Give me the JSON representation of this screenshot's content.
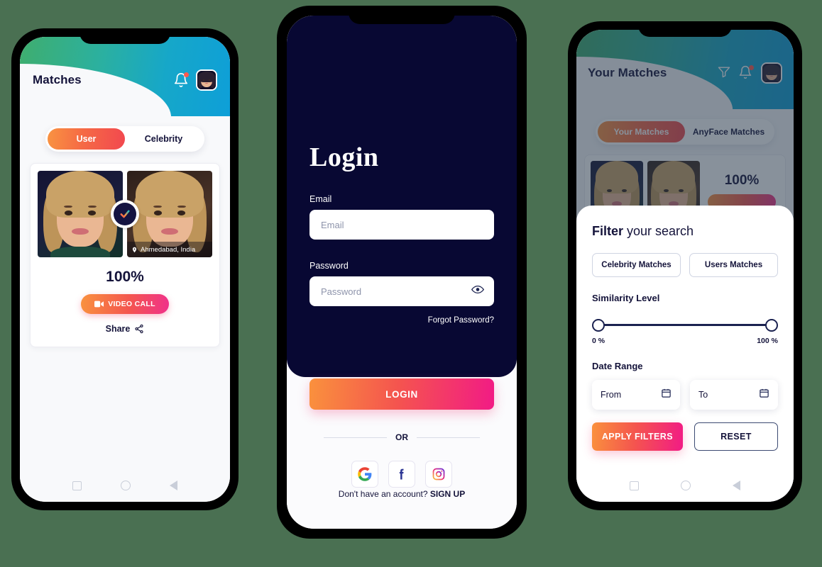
{
  "background_color": "#4a7052",
  "accent_gradient": [
    "#fa913d",
    "#f4544f",
    "#f21b85"
  ],
  "header_gradient": [
    "#3fae6e",
    "#2bb0a0",
    "#16a7c9",
    "#0e9fd8"
  ],
  "dark_navy": "#080833",
  "phone1": {
    "header": {
      "title": "Matches",
      "bell_icon": "bell-icon",
      "avatar_icon": "avatar"
    },
    "tabs": [
      {
        "label": "User",
        "active": true
      },
      {
        "label": "Celebrity",
        "active": false
      }
    ],
    "card": {
      "photo_left_alt": "match-photo-left",
      "photo_right_alt": "match-photo-right",
      "verified_icon": "check-badge-icon",
      "location_icon": "map-pin-icon",
      "location": "Ahmedabad, India",
      "match_percent": "100%",
      "video_call_label": "VIDEO CALL",
      "video_call_icon": "video-camera-icon",
      "share_label": "Share",
      "share_icon": "share-icon"
    },
    "navbar": [
      "square-icon",
      "circle-icon",
      "back-triangle-icon"
    ]
  },
  "phone2": {
    "title": "Login",
    "email": {
      "label": "Email",
      "placeholder": "Email",
      "value": ""
    },
    "password": {
      "label": "Password",
      "placeholder": "Password",
      "value": "",
      "toggle_icon": "eye-icon"
    },
    "forgot_password": "Forgot Password?",
    "login_button": "LOGIN",
    "divider": "OR",
    "socials": [
      {
        "name": "google-icon",
        "label": "Google"
      },
      {
        "name": "facebook-icon",
        "label": "Facebook"
      },
      {
        "name": "instagram-icon",
        "label": "Instagram"
      }
    ],
    "signup_prompt": "Don't have an account?",
    "signup_link": "SIGN UP"
  },
  "phone3": {
    "header": {
      "title": "Your Matches",
      "filter_icon": "filter-funnel-icon",
      "bell_icon": "bell-icon",
      "avatar_icon": "avatar"
    },
    "tabs": [
      {
        "label": "Your Matches",
        "active": true
      },
      {
        "label": "AnyFace Matches",
        "active": false
      }
    ],
    "card": {
      "match_percent": "100%"
    },
    "filter_sheet": {
      "title_bold": "Filter",
      "title_rest": " your search",
      "chips": [
        {
          "label": "Celebrity Matches"
        },
        {
          "label": "Users Matches"
        }
      ],
      "similarity_label": "Similarity Level",
      "slider_min": "0 %",
      "slider_max": "100 %",
      "date_range_label": "Date Range",
      "date_from_placeholder": "From",
      "date_to_placeholder": "To",
      "calendar_icon": "calendar-icon",
      "apply_label": "APPLY FILTERS",
      "reset_label": "RESET"
    },
    "navbar": [
      "square-icon",
      "circle-icon",
      "back-triangle-icon"
    ]
  }
}
